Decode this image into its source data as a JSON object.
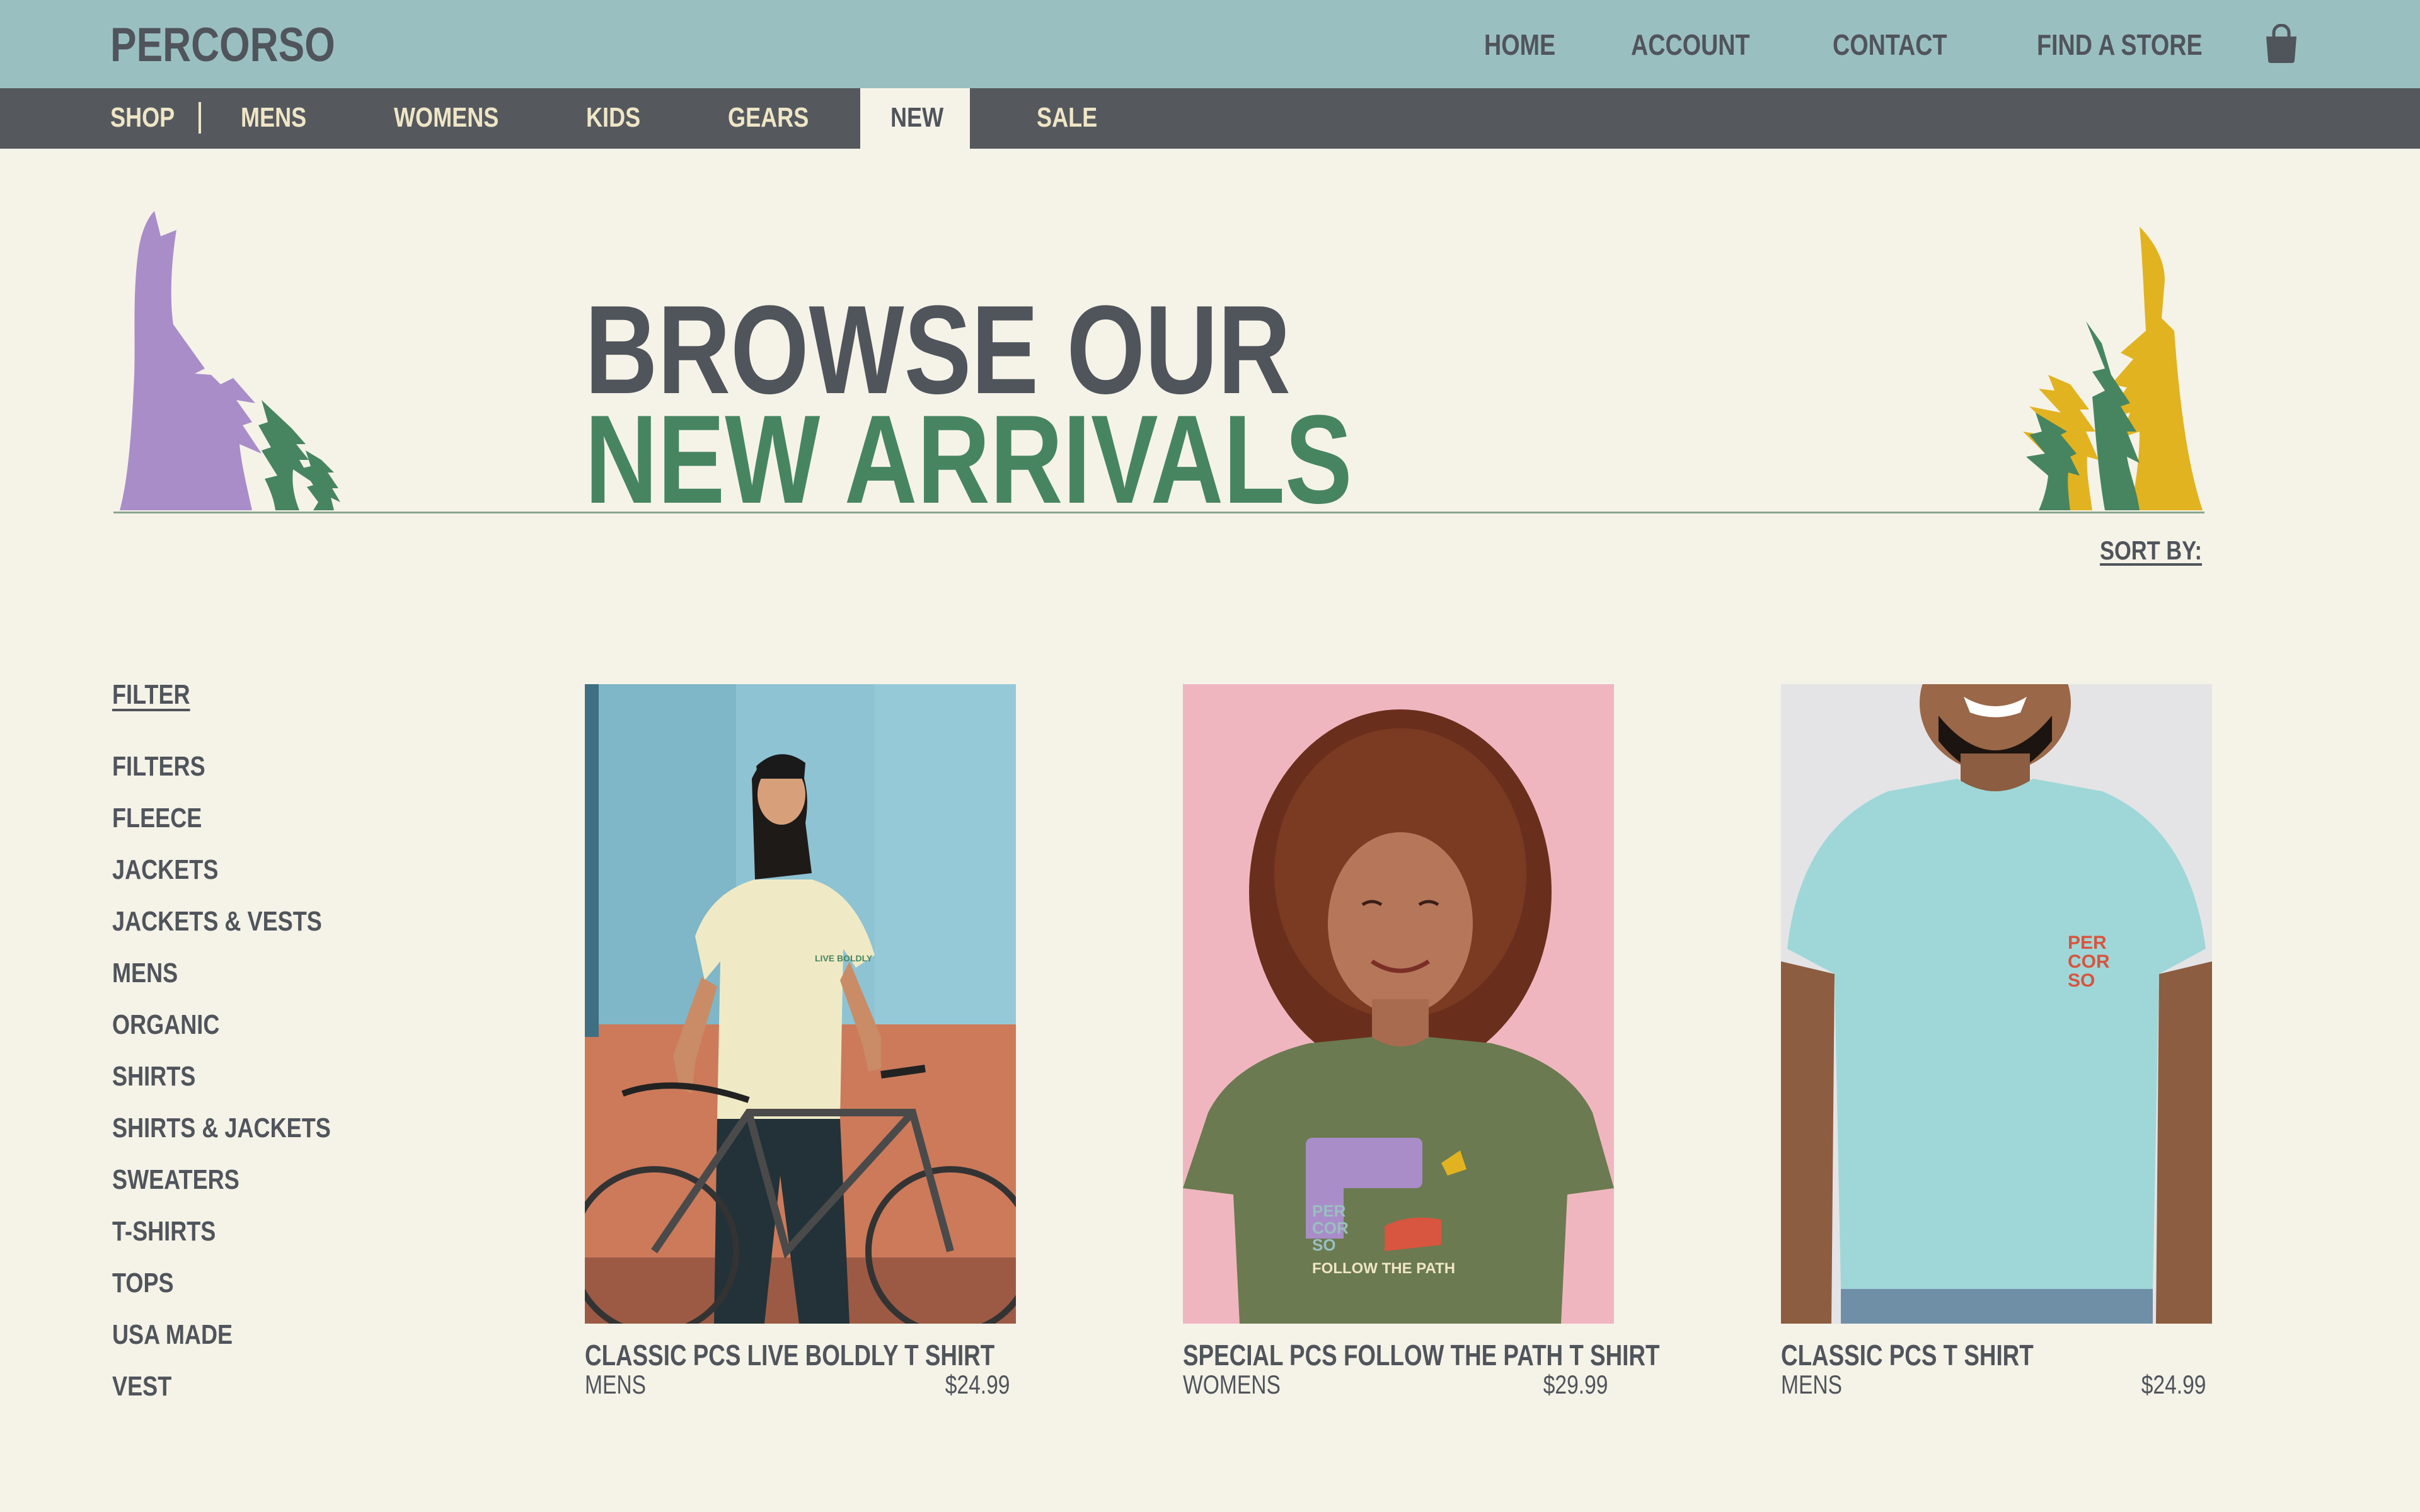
{
  "header": {
    "brand": "PERCORSO",
    "nav": [
      "HOME",
      "ACCOUNT",
      "CONTACT",
      "FIND A STORE"
    ],
    "cart_icon": "shopping-bag-icon"
  },
  "categories": {
    "shop_label": "SHOP",
    "items": [
      "MENS",
      "WOMENS",
      "KIDS",
      "GEARS",
      "NEW",
      "SALE"
    ],
    "active": "NEW"
  },
  "hero": {
    "line1": "BROWSE OUR",
    "line2": "NEW ARRIVALS"
  },
  "sort": {
    "label": "SORT BY:"
  },
  "filter": {
    "title": "FILTER",
    "items": [
      "FILTERS",
      "FLEECE",
      "JACKETS",
      "JACKETS & VESTS",
      "MENS",
      "ORGANIC",
      "SHIRTS",
      "SHIRTS & JACKETS",
      "SWEATERS",
      "T-SHIRTS",
      "TOPS",
      "USA MADE",
      "VEST"
    ]
  },
  "products": [
    {
      "name": "CLASSIC PCS LIVE BOLDLY T SHIRT",
      "category": "MENS",
      "price": "$24.99",
      "shirt_print": "LIVE BOLDLY"
    },
    {
      "name": "SPECIAL PCS FOLLOW THE PATH T SHIRT",
      "category": "WOMENS",
      "price": "$29.99",
      "shirt_print": "FOLLOW THE PATH"
    },
    {
      "name": "CLASSIC PCS T SHIRT",
      "category": "MENS",
      "price": "$24.99",
      "shirt_print": "PER COR SO"
    }
  ],
  "colors": {
    "topbar": "#9abfc0",
    "catbar": "#55595e",
    "background": "#f5f3e8",
    "text": "#50545b",
    "accent_green": "#478561",
    "tree_purple": "#a98dc9",
    "tree_yellow": "#e2b320"
  }
}
